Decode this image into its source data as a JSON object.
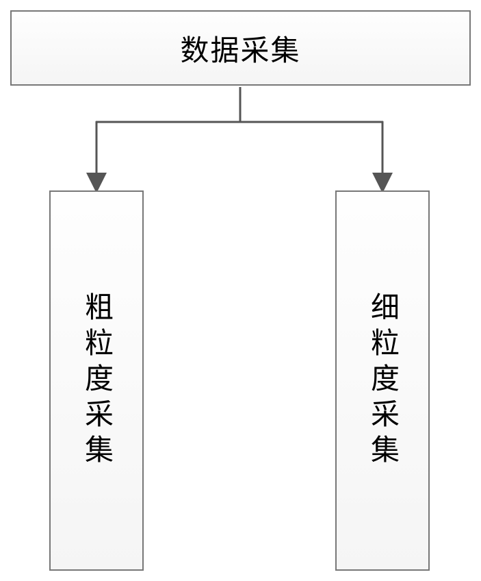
{
  "diagram": {
    "root": {
      "label": "数据采集"
    },
    "children": [
      {
        "id": "coarse",
        "label": "粗粒度采集"
      },
      {
        "id": "fine",
        "label": "细粒度采集"
      }
    ]
  }
}
